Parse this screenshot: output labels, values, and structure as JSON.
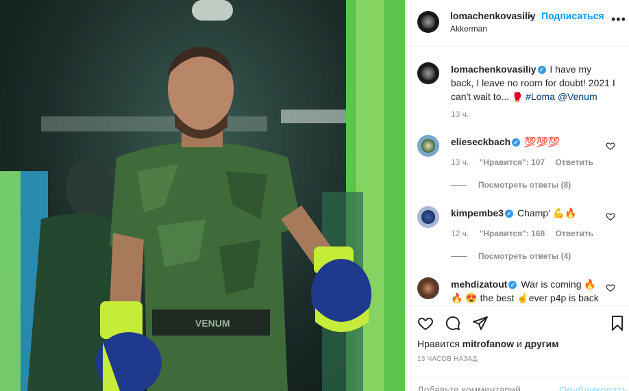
{
  "header": {
    "username": "lomachenkovasiliy",
    "dot": "•",
    "follow_label": "Подписаться",
    "location": "Akkerman",
    "more_icon": "more-horizontal-icon"
  },
  "caption": {
    "username": "lomachenkovasiliy",
    "text": "I have my back, I leave no room for doubt! 2021 I can't wait to...",
    "hashtag": "#Loma",
    "mention": "@Venum",
    "time": "13 ч."
  },
  "comments": [
    {
      "username": "elieseckbach",
      "text": "💯💯💯",
      "time": "13 ч.",
      "likes": "\"Нравится\": 107",
      "reply_label": "Ответить",
      "view_replies": "Посмотреть ответы (8)"
    },
    {
      "username": "kimpembe3",
      "text": "Champ' 💪🔥",
      "time": "12 ч.",
      "likes": "\"Нравится\": 168",
      "reply_label": "Ответить",
      "view_replies": "Посмотреть ответы (4)"
    },
    {
      "username": "mehdizatout",
      "text": "War is coming 🔥",
      "text2": "🔥 😍 the best ☝ever p4p is back"
    }
  ],
  "actions": {
    "like_icon": "heart-icon",
    "comment_icon": "comment-icon",
    "share_icon": "send-icon",
    "save_icon": "bookmark-icon",
    "likes_prefix": "Нравится",
    "likes_user": "mitrofanow",
    "likes_and": "и",
    "likes_others": "другим",
    "posted_time": "13 ЧАСОВ НАЗАД"
  },
  "add_comment": {
    "placeholder": "Добавьте комментарий...",
    "publish_label": "Опубликовать"
  },
  "colors": {
    "accent": "#0095f6",
    "verified": "#3897f0",
    "muted": "#8e8e8e",
    "publish_disabled": "#b2dffc"
  }
}
